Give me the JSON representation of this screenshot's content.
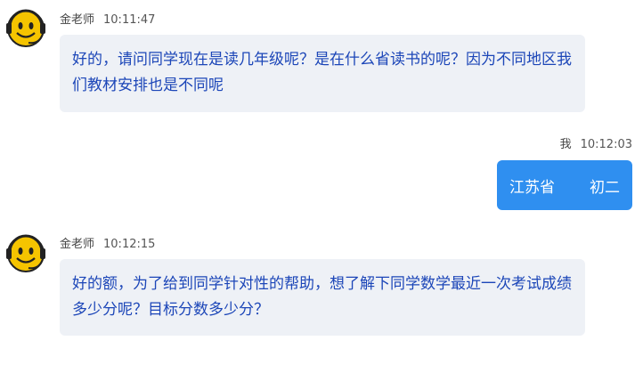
{
  "messages": [
    {
      "sender": "金老师",
      "time": "10:11:47",
      "text": "好的，请问同学现在是读几年级呢？是在什么省读书的呢？因为不同地区我们教材安排也是不同呢"
    },
    {
      "sender": "我",
      "time": "10:12:03",
      "province": "江苏省",
      "grade": "初二"
    },
    {
      "sender": "金老师",
      "time": "10:12:15",
      "text": "好的额，为了给到同学针对性的帮助，想了解下同学数学最近一次考试成绩多少分呢？目标分数多少分？"
    }
  ],
  "colors": {
    "incoming_bubble": "#eef1f6",
    "incoming_text": "#1c46b8",
    "outgoing_bubble": "#2f8ff0",
    "outgoing_text": "#ffffff",
    "avatar_face": "#f5c400"
  },
  "icons": {
    "teacher_avatar": "smiley-headset-icon"
  }
}
